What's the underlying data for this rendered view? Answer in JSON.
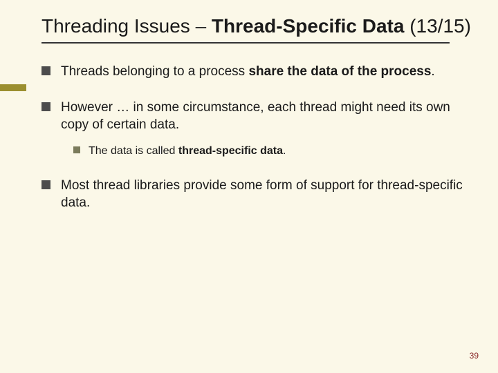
{
  "title": {
    "prefix": "Threading Issues – ",
    "bold": "Thread-Specific Data",
    "suffix": " (13/15)"
  },
  "bullets": [
    {
      "pre": "Threads belonging to a process ",
      "bold": "share the data of the process",
      "post": "."
    },
    {
      "pre": "However … in some circumstance, each thread might need its own copy of certain data.",
      "bold": "",
      "post": "",
      "sub": [
        {
          "pre": "The data is called ",
          "bold": "thread-specific data",
          "post": "."
        }
      ]
    },
    {
      "pre": "Most thread libraries provide some form of support for thread-specific data.",
      "bold": "",
      "post": ""
    }
  ],
  "page_number": "39"
}
